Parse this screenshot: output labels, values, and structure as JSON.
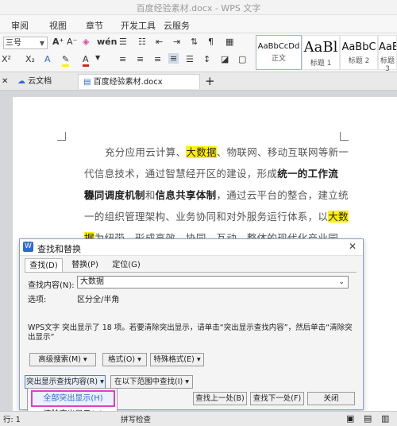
{
  "window": {
    "title": "百度经验素材.docx - WPS 文字"
  },
  "menu": [
    "审阅",
    "视图",
    "章节",
    "开发工具",
    "云服务"
  ],
  "ribbon": {
    "font_size": "三号",
    "styles": [
      {
        "preview": "AaBbCcDd",
        "label": "正文"
      },
      {
        "preview": "AaBl",
        "label": "标题 1"
      },
      {
        "preview": "AaBbC",
        "label": "标题 2"
      },
      {
        "preview": "AaB",
        "label": "标题 3"
      }
    ]
  },
  "tabs": [
    "云文档",
    "百度经验素材.docx"
  ],
  "document": {
    "lines": [
      [
        "充分应用云计算、",
        "大数据",
        "、物联网、移动互联网等新一"
      ],
      [
        "代信息技术，通过智慧经开区的建设，形成",
        "统一的工作流程",
        "、"
      ],
      [
        "协同调度机制",
        "和",
        "信息共享体制",
        "，通过云平台的整合，建立统"
      ],
      [
        "一的组织管理架构、业务协同和对外服务运行体系，以",
        "大数"
      ],
      [
        "据",
        "为纽带，形成高效、协同、互动、整体的现代化产业园区。"
      ]
    ]
  },
  "dialog": {
    "title": "查找和替换",
    "tabs": [
      "查找(D)",
      "替换(P)",
      "定位(G)"
    ],
    "find_label": "查找内容(N):",
    "find_value": "大数据",
    "options_label": "选项:",
    "options_value": "区分全/半角",
    "message": "WPS文字 突出显示了 18 项。若要清除突出显示，请单击“突出显示查找内容”，然后单击“清除突出显示”",
    "buttons": {
      "advanced": "高级搜索(M)",
      "format": "格式(O)",
      "special": "特殊格式(E)",
      "highlight": "突出显示查找内容(R)",
      "find_in": "在以下范围中查找(I)",
      "find_prev": "查找上一处(B)",
      "find_next": "查找下一处(F)",
      "close": "关闭"
    }
  },
  "popup": {
    "items": [
      "全部突出显示(H)",
      "清除突出显示(C)"
    ]
  },
  "status": {
    "row": "行: 1",
    "check": "拼写检查"
  },
  "colors": {
    "highlight": "#fff100",
    "accent": "#2f6bd1",
    "popup_border": "#e040c8"
  }
}
